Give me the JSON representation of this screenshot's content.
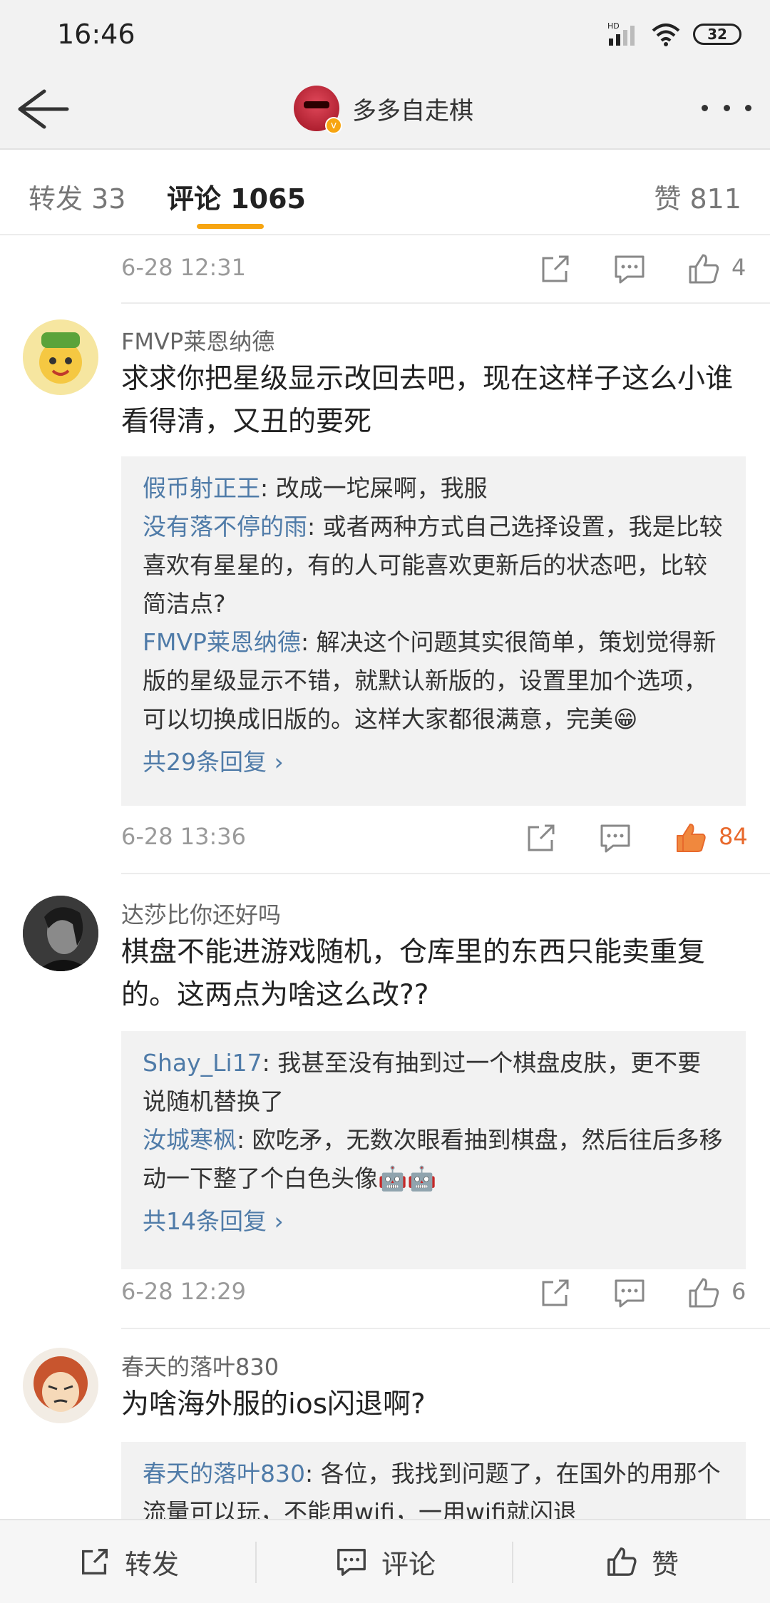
{
  "status": {
    "time": "16:46",
    "battery": "32",
    "network": "HD"
  },
  "nav": {
    "title": "多多自走棋"
  },
  "tabs": {
    "repost": "转发 33",
    "comment": "评论 1065",
    "likes": "赞 811"
  },
  "comments": [
    {
      "date": "6-28 12:31",
      "likes": "4"
    },
    {
      "user": "FMVP莱恩纳德",
      "text": "求求你把星级显示改回去吧，现在这样子这么小谁看得清，又丑的要死",
      "replies": [
        {
          "user": "假币射正王",
          "text": ": 改成一坨屎啊，我服"
        },
        {
          "user": "没有落不停的雨",
          "text": ": 或者两种方式自己选择设置，我是比较喜欢有星星的，有的人可能喜欢更新后的状态吧，比较简洁点?"
        },
        {
          "user": "FMVP莱恩纳德",
          "text": ": 解决这个问题其实很简单，策划觉得新版的星级显示不错，就默认新版的，设置里加个选项，可以切换成旧版的。这样大家都很满意，完美😁"
        }
      ],
      "more": "共29条回复 ›",
      "date": "6-28 13:36",
      "likes": "84"
    },
    {
      "user": "达莎比你还好吗",
      "text": "棋盘不能进游戏随机，仓库里的东西只能卖重复的。这两点为啥这么改??",
      "replies": [
        {
          "user": "Shay_Li17",
          "text": ": 我甚至没有抽到过一个棋盘皮肤，更不要说随机替换了"
        },
        {
          "user": "汝城寒枫",
          "text": ": 欧吃矛，无数次眼看抽到棋盘，然后往后多移动一下整了个白色头像🤖🤖"
        }
      ],
      "more": "共14条回复 ›",
      "date": "6-28 12:29",
      "likes": "6"
    },
    {
      "user": "春天的落叶830",
      "text": "为啥海外服的ios闪退啊?",
      "replies": [
        {
          "user": "春天的落叶830",
          "text": ": 各位，我找到问题了，在国外的用那个流量可以玩，不能用wifi，一用wifi就闪退"
        }
      ]
    }
  ],
  "bottom": {
    "repost": "转发",
    "comment": "评论",
    "like": "赞"
  },
  "colors": {
    "accent": "#f7a511",
    "link": "#4f7ba8",
    "liked": "#e8692c"
  }
}
